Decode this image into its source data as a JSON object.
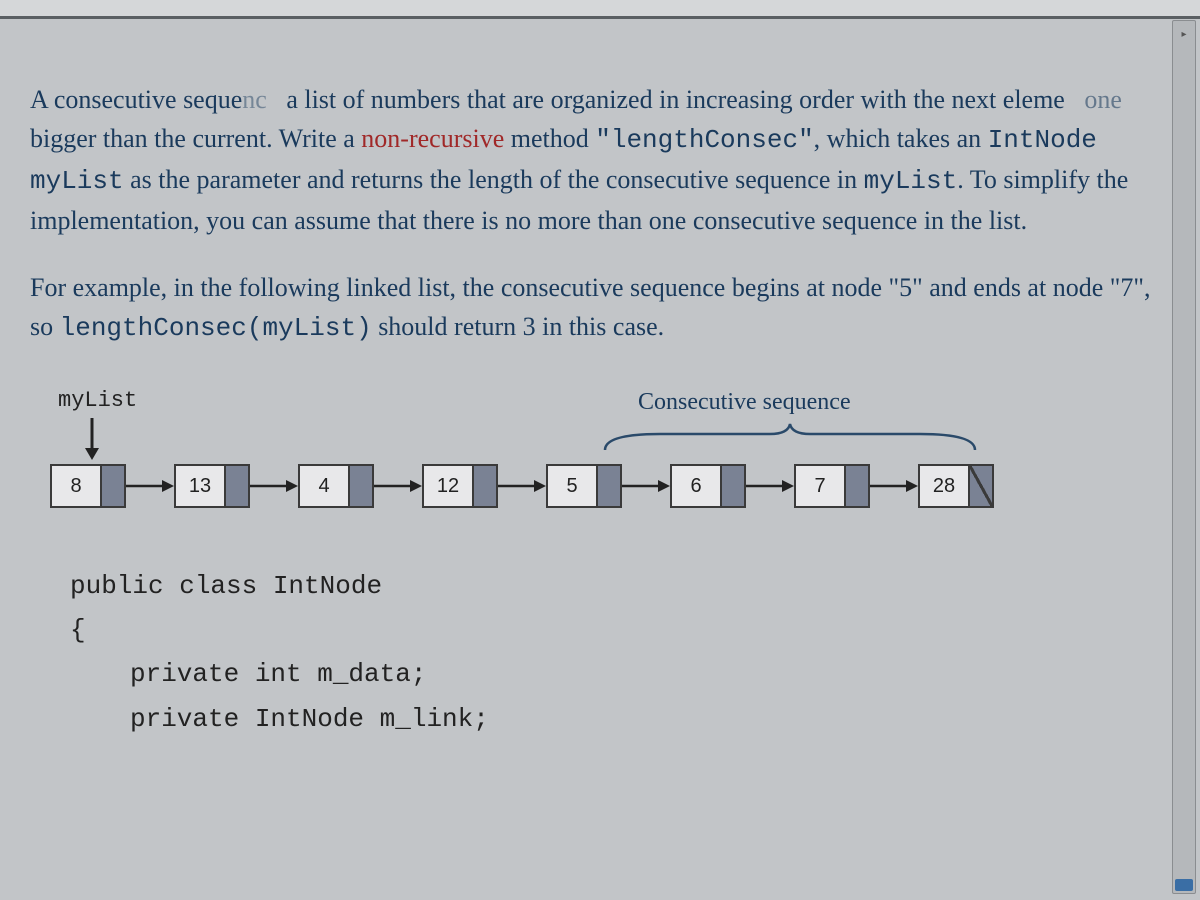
{
  "problem": {
    "para1_part1": "A consecutive seque",
    "para1_gap1": "nc",
    "para1_part2": "a list of numbers that are organized in increasing order with the next eleme",
    "para1_gap2": "one",
    "para1_part3": " bigger than the current. Write a ",
    "para1_red": "non-recursive",
    "para1_part4": " method ",
    "para1_code1": "\"lengthConsec\"",
    "para1_part5": ", which takes an ",
    "para1_code2": "IntNode myList",
    "para1_part6": " as the parameter and returns the length of the consecutive sequence in ",
    "para1_code3": "myList",
    "para1_part7": ". To simplify the implementation, you can assume that there is no more than one consecutive sequence in the list.",
    "para2_part1": "For example, in the following linked list, the consecutive sequence begins at node \"5\" and ends at node \"7\", so ",
    "para2_code1": "lengthConsec(myList)",
    "para2_part2": " should return 3 in this case."
  },
  "diagram": {
    "mylist_label": "myList",
    "consec_label": "Consecutive sequence",
    "nodes": [
      "8",
      "13",
      "4",
      "12",
      "5",
      "6",
      "7",
      "28"
    ]
  },
  "code": {
    "line1": "public class IntNode",
    "line2": "{",
    "line3": "private int m_data;",
    "line4": "private IntNode m_link;"
  }
}
